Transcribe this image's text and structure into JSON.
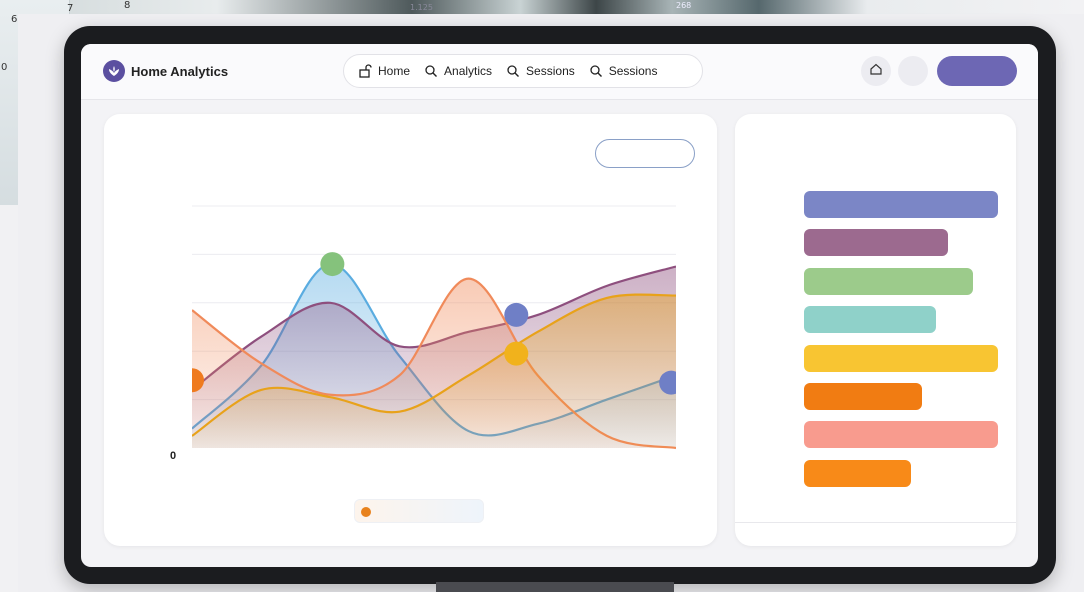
{
  "background": {
    "paper_numbers": [
      "6",
      "7",
      "8",
      "0"
    ],
    "photo_numbers": [
      "1.125",
      "268"
    ]
  },
  "app": {
    "title": "Home Analytics",
    "accent": "#6d67b4"
  },
  "nav": {
    "items": [
      {
        "label": "Home",
        "icon": "lock-open-icon"
      },
      {
        "label": "Analytics",
        "icon": "search-icon"
      },
      {
        "label": "Sessions",
        "icon": "search-icon"
      },
      {
        "label": "Sessions",
        "icon": "search-icon"
      }
    ]
  },
  "header_actions": {
    "home_icon": "home-icon"
  },
  "chart_data": {
    "type": "area",
    "ylabel_zero": "0",
    "series": [
      {
        "color": "#5aace0",
        "values": [
          0.08,
          0.34,
          0.76,
          0.38,
          0.07,
          0.1,
          0.2,
          0.3
        ]
      },
      {
        "color": "#8e4f7e",
        "values": [
          0.24,
          0.46,
          0.6,
          0.42,
          0.48,
          0.55,
          0.67,
          0.75
        ]
      },
      {
        "color": "#f08a5a",
        "values": [
          0.57,
          0.35,
          0.22,
          0.3,
          0.7,
          0.3,
          0.05,
          0.0
        ]
      },
      {
        "color": "#e8a21a",
        "values": [
          0.05,
          0.24,
          0.21,
          0.15,
          0.3,
          0.48,
          0.62,
          0.63
        ]
      }
    ],
    "markers": [
      {
        "x": 0.0,
        "y": 0.28,
        "color": "#ef7b1f"
      },
      {
        "x": 0.29,
        "y": 0.76,
        "color": "#85c27c"
      },
      {
        "x": 0.67,
        "y": 0.55,
        "color": "#6f7fc6"
      },
      {
        "x": 0.67,
        "y": 0.39,
        "color": "#f1b21c"
      },
      {
        "x": 0.99,
        "y": 0.27,
        "color": "#6f7fc6"
      }
    ]
  },
  "side_bars": [
    {
      "value": 1.0,
      "color": "#7b86c6"
    },
    {
      "value": 0.74,
      "color": "#9c6a8f"
    },
    {
      "value": 0.87,
      "color": "#9ccb8b"
    },
    {
      "value": 0.68,
      "color": "#8fd1c9"
    },
    {
      "value": 1.0,
      "color": "#f8c532"
    },
    {
      "value": 0.61,
      "color": "#f17c12"
    },
    {
      "value": 1.0,
      "color": "#f89b8e"
    },
    {
      "value": 0.55,
      "color": "#f88a18"
    }
  ]
}
